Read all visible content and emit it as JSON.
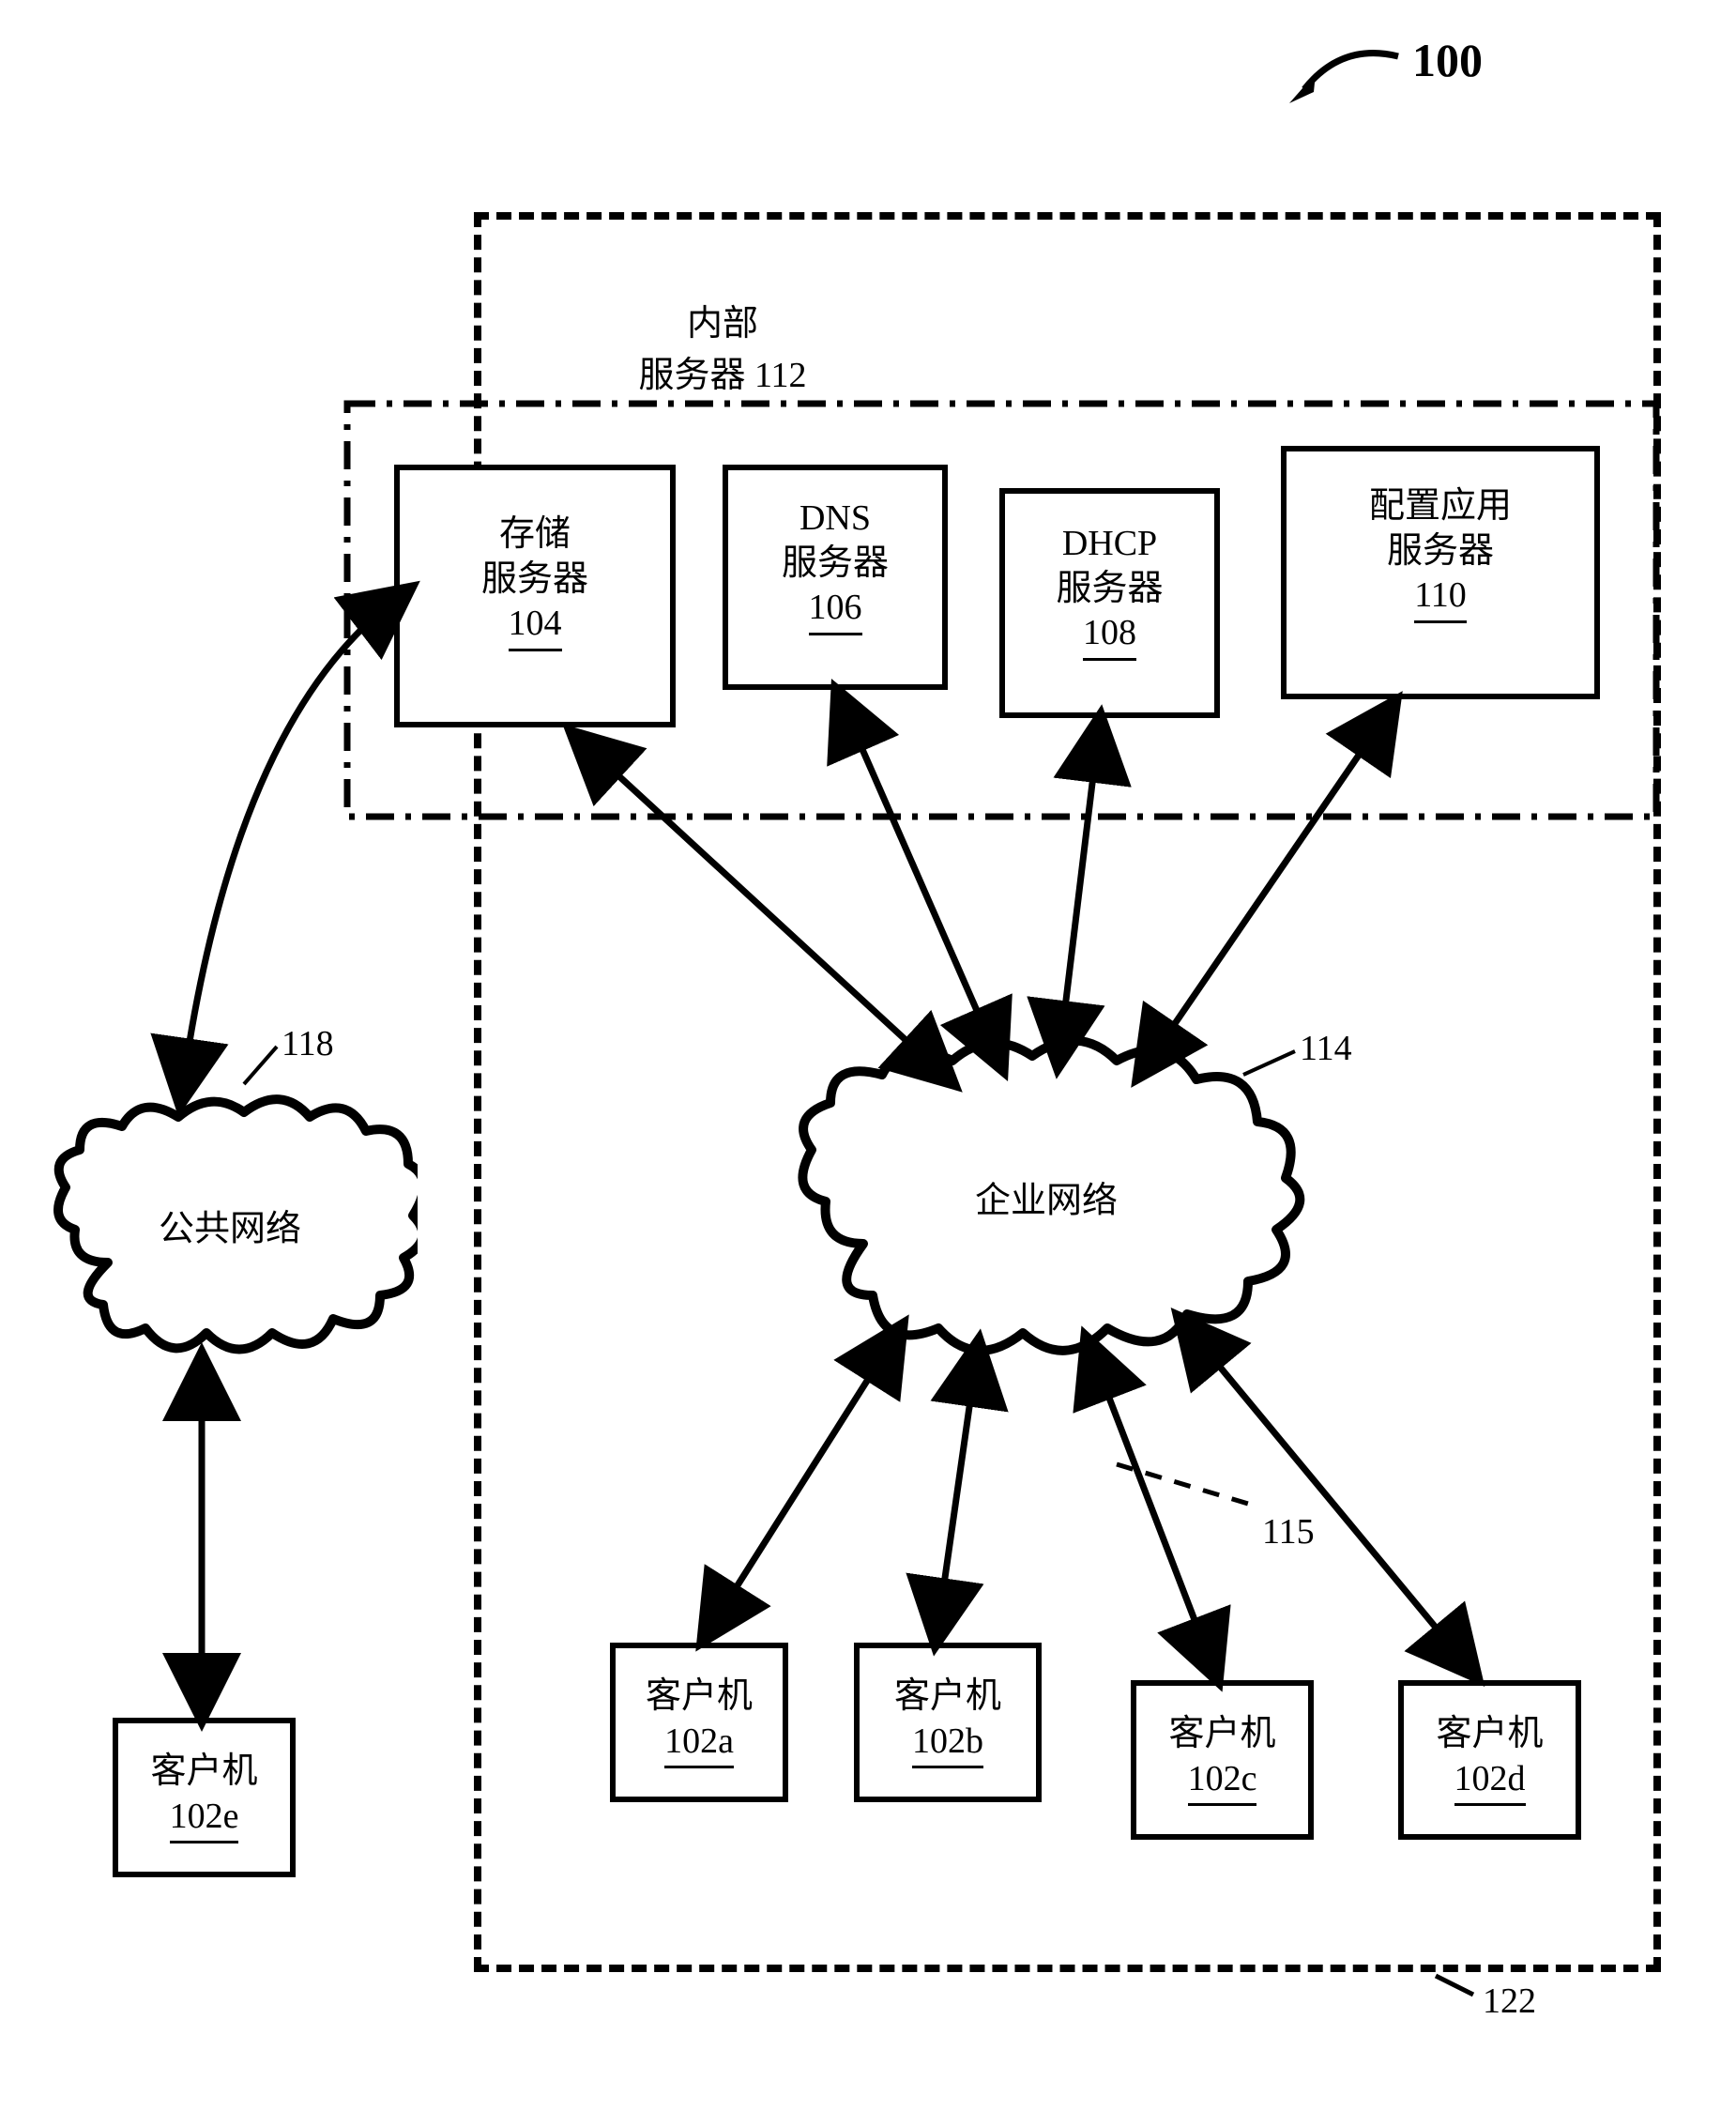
{
  "figure": {
    "number_label": "100",
    "arrow_caption": ""
  },
  "labels": {
    "internal_servers_title_line1": "内部",
    "internal_servers_title_line2": "服务器",
    "internal_servers_num": "112",
    "enterprise_network": "企业网络",
    "public_network": "公共网络",
    "public_network_ref": "118",
    "enterprise_network_ref": "114",
    "link_ref": "115",
    "outer_box_ref": "122"
  },
  "servers": {
    "storage": {
      "title": "存储\n服务器",
      "num": "104"
    },
    "dns": {
      "title": "DNS\n服务器",
      "num": "106"
    },
    "dhcp": {
      "title": "DHCP\n服务器",
      "num": "108"
    },
    "config": {
      "title": "配置应用\n服务器",
      "num": "110"
    }
  },
  "clients": {
    "a": {
      "title": "客户机",
      "num": "102a"
    },
    "b": {
      "title": "客户机",
      "num": "102b"
    },
    "c": {
      "title": "客户机",
      "num": "102c"
    },
    "d": {
      "title": "客户机",
      "num": "102d"
    },
    "e": {
      "title": "客户机",
      "num": "102e"
    }
  }
}
